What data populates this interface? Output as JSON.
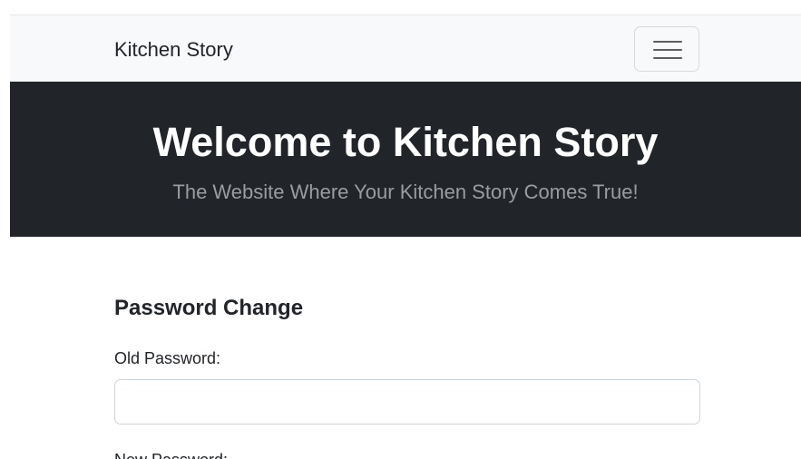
{
  "navbar": {
    "brand": "Kitchen Story",
    "toggler_icon": "hamburger-menu-icon"
  },
  "hero": {
    "title": "Welcome to Kitchen Story",
    "subtitle": "The Website Where Your Kitchen Story Comes True!"
  },
  "form": {
    "heading": "Password Change",
    "old_password_label": "Old Password:",
    "old_password_value": "",
    "old_password_placeholder": "",
    "new_password_label": "New Password:"
  },
  "colors": {
    "navbar_bg": "#f8f9fa",
    "hero_bg": "#212529",
    "hero_title": "#ffffff",
    "hero_subtitle": "#9a9da0"
  }
}
